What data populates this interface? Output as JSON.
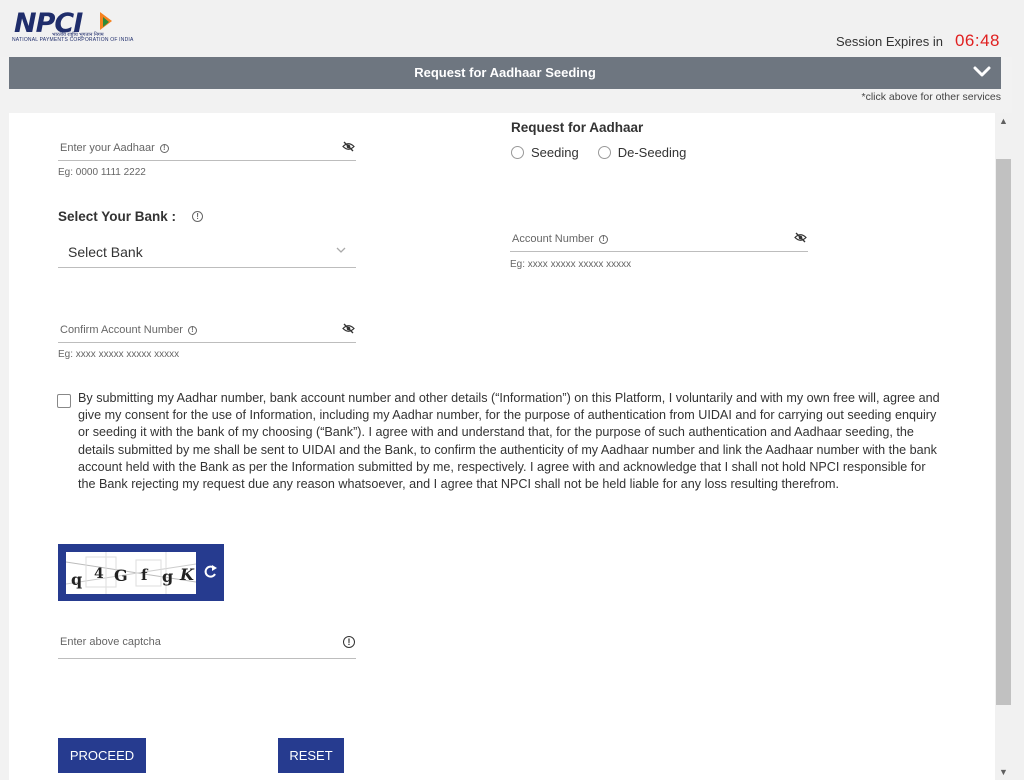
{
  "header": {
    "logo_text": "NPCI",
    "logo_hindi": "भारतीय राष्ट्रीय भुगतान निगम",
    "logo_tagline": "NATIONAL PAYMENTS CORPORATION OF INDIA",
    "session_label": "Session Expires in",
    "session_time": "06:48"
  },
  "service_bar": {
    "title": "Request for Aadhaar Seeding",
    "hint": "*click above for other services"
  },
  "form": {
    "aadhaar": {
      "label": "Enter your Aadhaar",
      "hint": "Eg: 0000 1111 2222"
    },
    "request": {
      "title": "Request for Aadhaar",
      "options": [
        "Seeding",
        "De-Seeding"
      ]
    },
    "bank": {
      "title": "Select Your Bank :",
      "selected": "Select Bank"
    },
    "account": {
      "label": "Account Number",
      "hint": "Eg: xxxx xxxxx xxxxx xxxxx"
    },
    "confirm_account": {
      "label": "Confirm Account Number",
      "hint": "Eg: xxxx xxxxx xxxxx xxxxx"
    },
    "consent_text": "By submitting my Aadhar number, bank account number and other details (“Information”) on this Platform, I voluntarily and with my own free will, agree and give my consent for the use of Information, including my Aadhar number, for the purpose of authentication from UIDAI and for carrying out seeding enquiry or seeding it with the bank of my choosing (“Bank”). I agree with and understand that, for the purpose of such authentication and Aadhaar seeding, the details submitted by me shall be sent to UIDAI and the Bank, to confirm the authenticity of my Aadhaar number and link the Aadhaar number with the bank account held with the Bank as per the Information submitted by me, respectively. I agree with and acknowledge that I shall not hold NPCI responsible for the Bank rejecting my request due any reason whatsoever, and I agree that NPCI shall not be held liable for any loss resulting therefrom.",
    "captcha": {
      "chars": [
        "q",
        "4",
        "G",
        "f",
        "g",
        "K"
      ],
      "placeholder": "Enter above captcha"
    }
  },
  "buttons": {
    "proceed": "PROCEED",
    "reset": "RESET"
  },
  "colors": {
    "brand": "#263b8f",
    "bar": "#6e7680",
    "timer": "#e02020"
  },
  "icons": [
    "info-icon",
    "eye-slash-icon",
    "chevron-down-icon",
    "refresh-icon"
  ]
}
